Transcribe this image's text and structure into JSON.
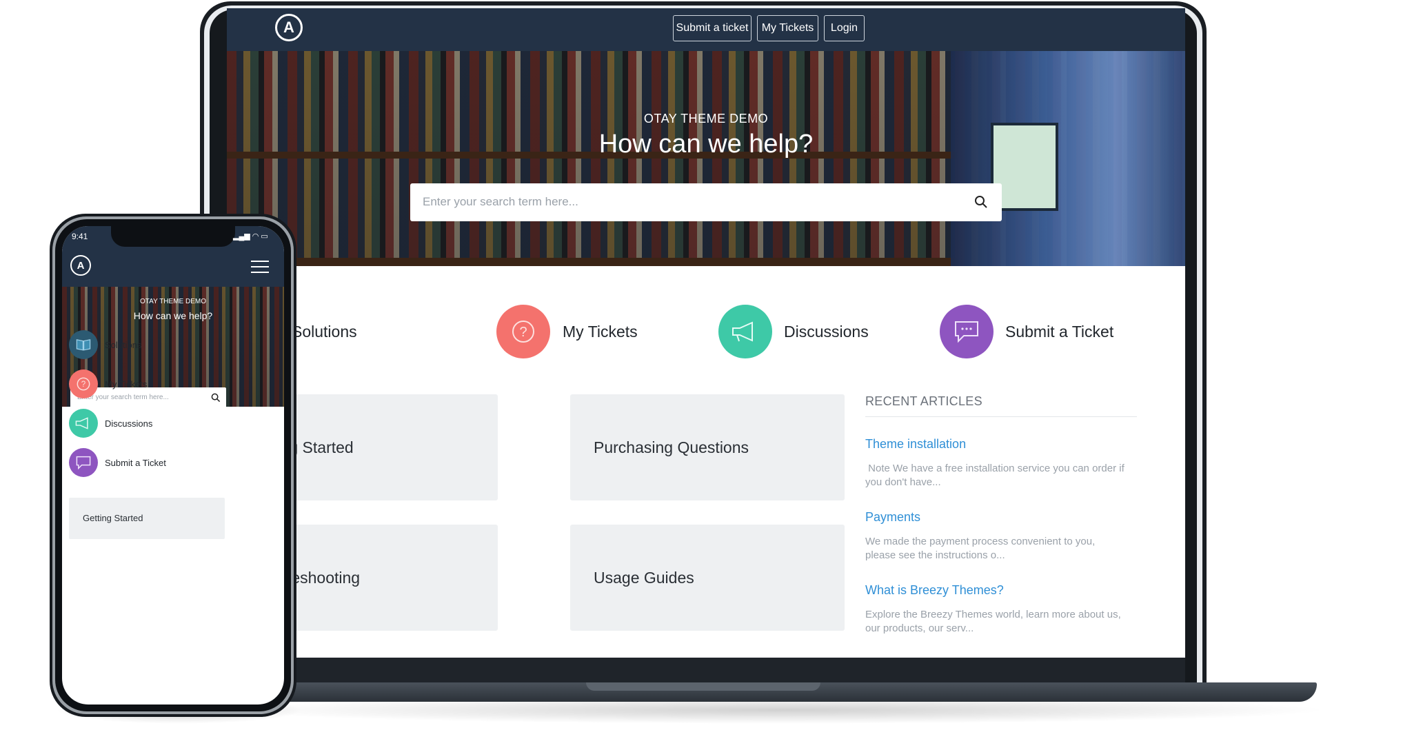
{
  "laptop": {
    "nav": {
      "submit_ticket": "Submit a ticket",
      "my_tickets": "My Tickets",
      "login": "Login"
    },
    "hero": {
      "subtitle": "OTAY THEME DEMO",
      "title": "How can we help?",
      "search_placeholder": "Enter your search term here..."
    },
    "categories": [
      {
        "label": "Solutions",
        "icon": "book-icon",
        "color": "#2c5a72"
      },
      {
        "label": "My Tickets",
        "icon": "question-icon",
        "color": "#f4726d"
      },
      {
        "label": "Discussions",
        "icon": "megaphone-icon",
        "color": "#3ec9a7"
      },
      {
        "label": "Submit a Ticket",
        "icon": "chat-icon",
        "color": "#8e55c0"
      }
    ],
    "cards": [
      {
        "label": "Getting Started"
      },
      {
        "label": "Purchasing Questions"
      },
      {
        "label": "Troubleshooting"
      },
      {
        "label": "Usage Guides"
      }
    ],
    "recent": {
      "heading": "RECENT ARTICLES",
      "articles": [
        {
          "title": "Theme installation",
          "desc": " Note We have a free installation service you can order if you don't have..."
        },
        {
          "title": "Payments",
          "desc": "We made the payment process convenient to you, please see the instructions o..."
        },
        {
          "title": "What is Breezy Themes?",
          "desc": "Explore the Breezy Themes world, learn more about us, our products, our serv..."
        }
      ]
    }
  },
  "phone": {
    "time": "9:41",
    "status": "▂▄▆ ◠ ▭",
    "hero": {
      "subtitle": "OTAY THEME DEMO",
      "title": "How can we help?",
      "search_placeholder": "Enter your search term here..."
    },
    "categories": [
      {
        "label": "Solutions"
      },
      {
        "label": "My Tickets"
      },
      {
        "label": "Discussions"
      },
      {
        "label": "Submit a Ticket"
      }
    ],
    "card": {
      "label": "Getting Started"
    }
  },
  "logo_letter": "A",
  "colors": {
    "nav": "#233246",
    "link": "#2f8fd6",
    "card": "#eef0f2"
  }
}
